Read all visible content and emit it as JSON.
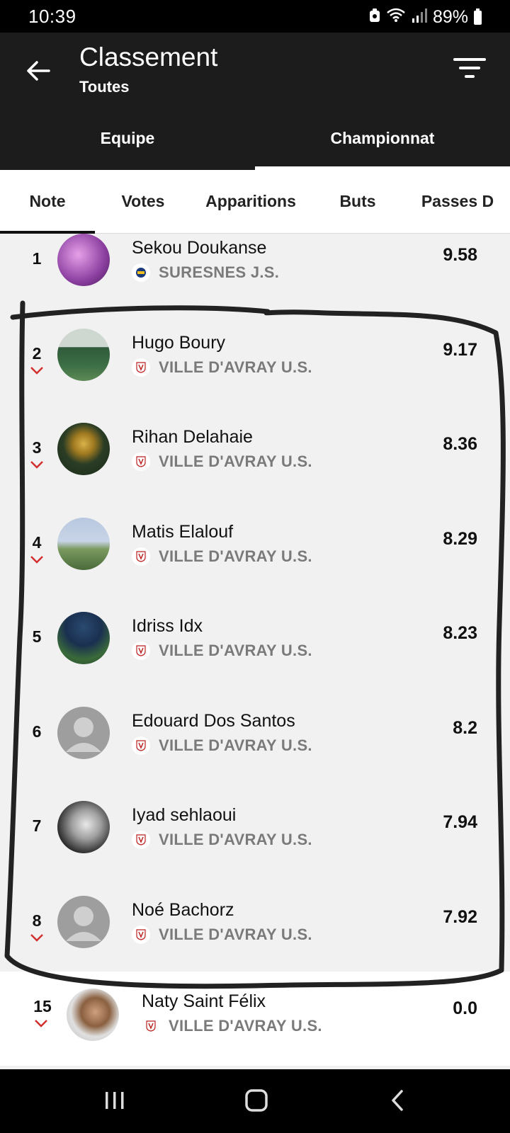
{
  "statusbar": {
    "time": "10:39",
    "battery": "89%"
  },
  "appbar": {
    "title": "Classement",
    "subtitle": "Toutes"
  },
  "tabs_top": [
    {
      "label": "Equipe",
      "active": false
    },
    {
      "label": "Championnat",
      "active": true
    }
  ],
  "tabs_sub": [
    {
      "label": "Note",
      "active": true
    },
    {
      "label": "Votes",
      "active": false
    },
    {
      "label": "Apparitions",
      "active": false
    },
    {
      "label": "Buts",
      "active": false
    },
    {
      "label": "Passes D",
      "active": false
    }
  ],
  "players": [
    {
      "rank": "1",
      "name": "Sekou Doukanse",
      "club": "SURESNES J.S.",
      "score": "9.58",
      "trend": "none"
    },
    {
      "rank": "2",
      "name": "Hugo Boury",
      "club": "VILLE D'AVRAY U.S.",
      "score": "9.17",
      "trend": "down"
    },
    {
      "rank": "3",
      "name": "Rihan Delahaie",
      "club": "VILLE D'AVRAY U.S.",
      "score": "8.36",
      "trend": "down"
    },
    {
      "rank": "4",
      "name": "Matis Elalouf",
      "club": "VILLE D'AVRAY U.S.",
      "score": "8.29",
      "trend": "down"
    },
    {
      "rank": "5",
      "name": "Idriss Idx",
      "club": "VILLE D'AVRAY U.S.",
      "score": "8.23",
      "trend": "none"
    },
    {
      "rank": "6",
      "name": "Edouard Dos Santos",
      "club": "VILLE D'AVRAY U.S.",
      "score": "8.2",
      "trend": "none"
    },
    {
      "rank": "7",
      "name": "Iyad sehlaoui",
      "club": "VILLE D'AVRAY U.S.",
      "score": "7.94",
      "trend": "none"
    },
    {
      "rank": "8",
      "name": "Noé Bachorz",
      "club": "VILLE D'AVRAY U.S.",
      "score": "7.92",
      "trend": "down"
    }
  ],
  "current_player": {
    "rank": "15",
    "name": "Naty Saint Félix",
    "club": "VILLE D'AVRAY U.S.",
    "score": "0.0",
    "trend": "down"
  },
  "colors": {
    "trend_down": "#d32f2f",
    "appbar_bg": "#1c1c1c",
    "club_text": "#7a7a7a"
  }
}
